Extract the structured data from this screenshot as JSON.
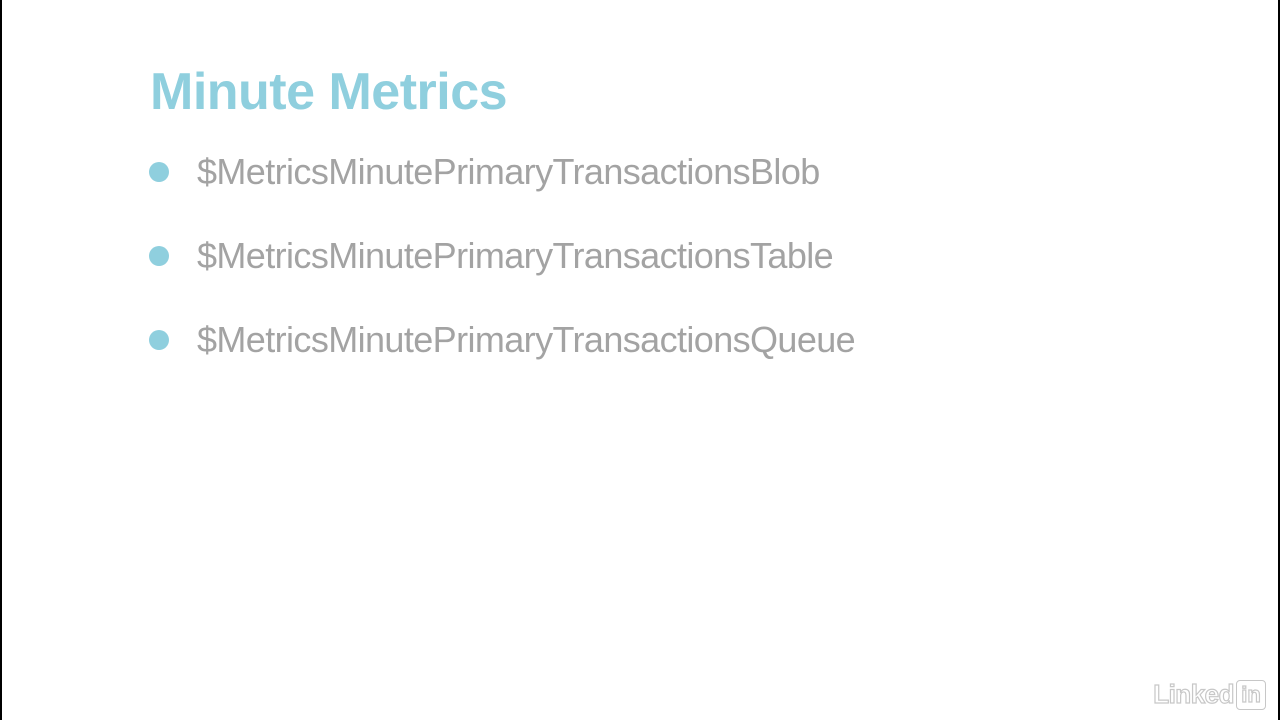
{
  "slide": {
    "title": "Minute Metrics",
    "bullets": [
      {
        "text": "$MetricsMinutePrimaryTransactionsBlob"
      },
      {
        "text": "$MetricsMinutePrimaryTransactionsTable"
      },
      {
        "text": "$MetricsMinutePrimaryTransactionsQueue"
      }
    ]
  },
  "watermark": {
    "brand_text": "Linked",
    "brand_box": "in",
    "icon": "linkedin-logo-icon"
  },
  "colors": {
    "accent": "#8fcfde",
    "bullet_text": "#a3a3a3",
    "background": "#ffffff",
    "frame": "#000000"
  }
}
